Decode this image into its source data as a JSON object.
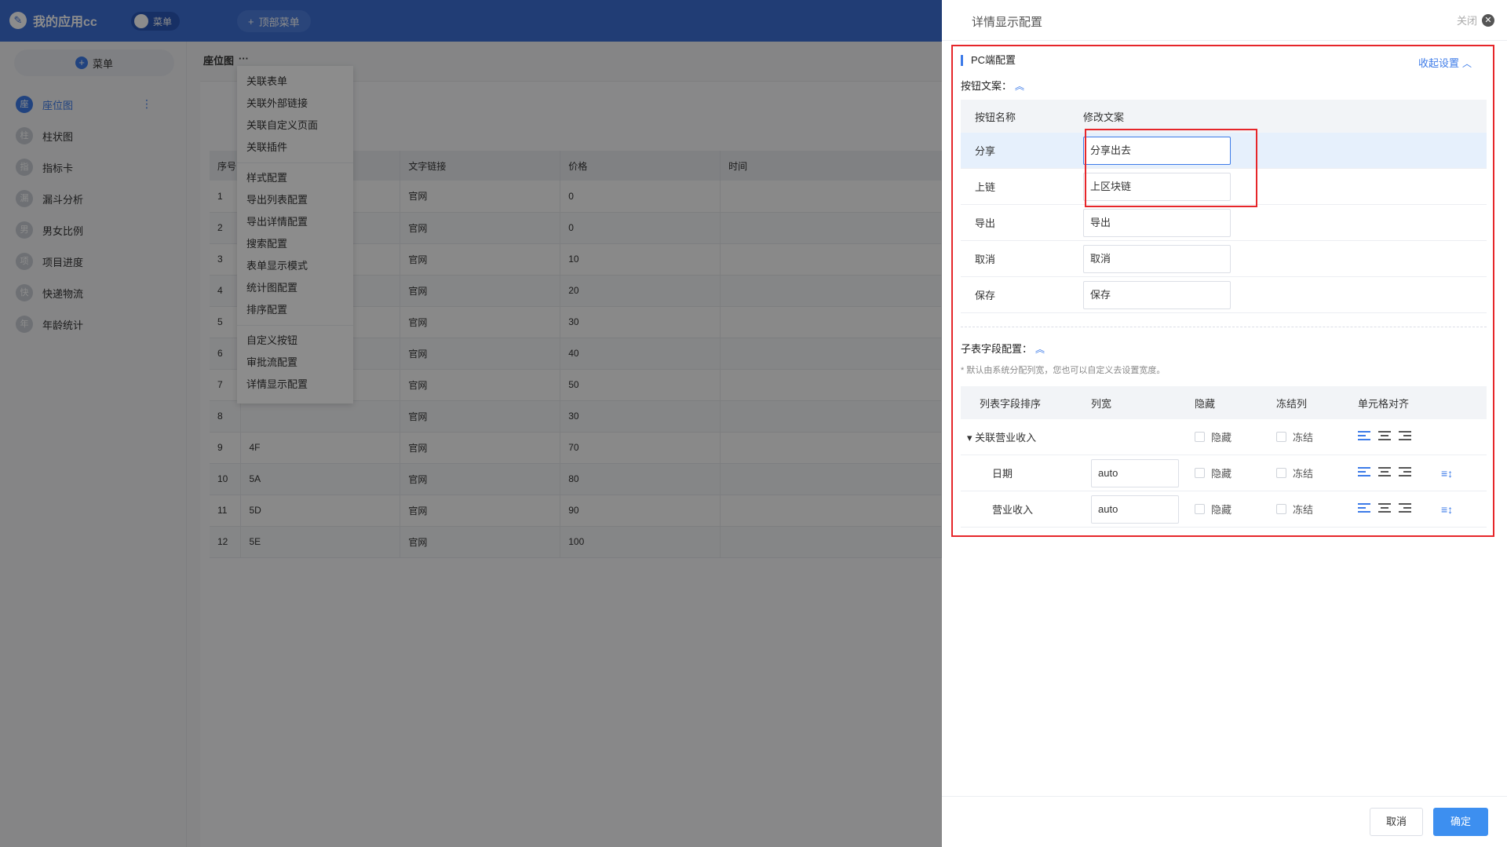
{
  "app": {
    "logo_text": "我的应用cc",
    "toggle_label": "菜单",
    "top_menu_label": "顶部菜单",
    "side_add_label": "菜单",
    "sidebar": [
      {
        "badge": "座",
        "label": "座位图",
        "active": true
      },
      {
        "badge": "柱",
        "label": "柱状图"
      },
      {
        "badge": "指",
        "label": "指标卡"
      },
      {
        "badge": "漏",
        "label": "漏斗分析"
      },
      {
        "badge": "男",
        "label": "男女比例"
      },
      {
        "badge": "项",
        "label": "项目进度"
      },
      {
        "badge": "快",
        "label": "快递物流"
      },
      {
        "badge": "年",
        "label": "年龄统计"
      }
    ],
    "breadcrumb": "座位图",
    "breadcrumb_more": "···",
    "table": {
      "headers": [
        "序号",
        "",
        "文字链接",
        "价格",
        "时间"
      ],
      "rows": [
        [
          "1",
          "",
          "官网",
          "0",
          ""
        ],
        [
          "2",
          "",
          "官网",
          "0",
          ""
        ],
        [
          "3",
          "",
          "官网",
          "10",
          ""
        ],
        [
          "4",
          "",
          "官网",
          "20",
          ""
        ],
        [
          "5",
          "",
          "官网",
          "30",
          ""
        ],
        [
          "6",
          "",
          "官网",
          "40",
          ""
        ],
        [
          "7",
          "",
          "官网",
          "50",
          ""
        ],
        [
          "8",
          "",
          "官网",
          "30",
          ""
        ],
        [
          "9",
          "4F",
          "官网",
          "70",
          ""
        ],
        [
          "10",
          "5A",
          "官网",
          "80",
          ""
        ],
        [
          "11",
          "5D",
          "官网",
          "90",
          ""
        ],
        [
          "12",
          "5E",
          "官网",
          "100",
          ""
        ]
      ]
    },
    "dropdown": {
      "group1": [
        "关联表单",
        "关联外部链接",
        "关联自定义页面",
        "关联插件"
      ],
      "group2": [
        "样式配置",
        "导出列表配置",
        "导出详情配置",
        "搜索配置",
        "表单显示模式",
        "统计图配置",
        "排序配置"
      ],
      "group3": [
        "自定义按钮",
        "审批流配置",
        "详情显示配置"
      ]
    }
  },
  "drawer": {
    "title": "详情显示配置",
    "close_label": "关闭",
    "pc_section": "PC端配置",
    "collapse_label": "收起设置",
    "button_text_label": "按钮文案：",
    "btn_grid": {
      "header_name": "按钮名称",
      "header_edit": "修改文案",
      "rows": [
        {
          "name": "分享",
          "value": "分享出去"
        },
        {
          "name": "上链",
          "value": "上区块链"
        },
        {
          "name": "导出",
          "value": "导出"
        },
        {
          "name": "取消",
          "value": "取消"
        },
        {
          "name": "保存",
          "value": "保存"
        }
      ]
    },
    "sub_field_label": "子表字段配置：",
    "sub_note": "* 默认由系统分配列宽，您也可以自定义去设置宽度。",
    "sub_grid": {
      "headers": [
        "列表字段排序",
        "列宽",
        "隐藏",
        "冻结列",
        "单元格对齐"
      ],
      "hide_label": "隐藏",
      "freeze_label": "冻结",
      "parent": "关联营业收入",
      "children": [
        {
          "name": "日期",
          "width": "auto"
        },
        {
          "name": "营业收入",
          "width": "auto"
        }
      ]
    },
    "footer": {
      "cancel": "取消",
      "ok": "确定"
    }
  }
}
